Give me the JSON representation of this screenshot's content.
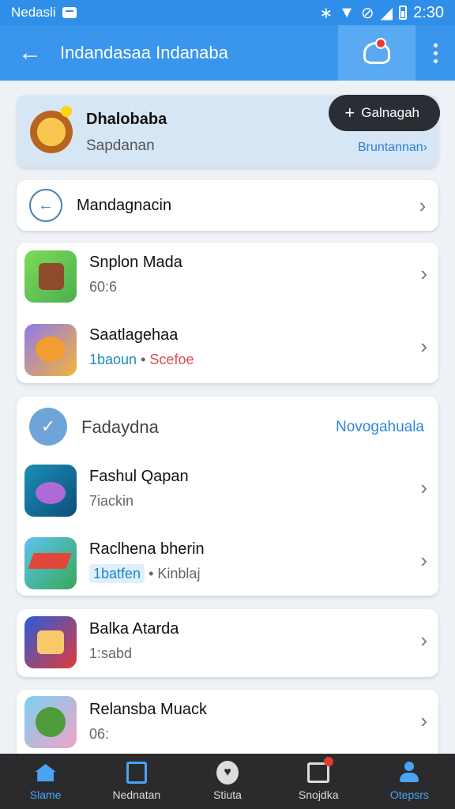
{
  "status_bar": {
    "carrier": "Nedasli",
    "time": "2:30"
  },
  "app_bar": {
    "title": "Indandasaa Indanaba"
  },
  "profile": {
    "name": "Dhalobaba",
    "subtitle": "Sapdanan",
    "join_label": "Galnagah",
    "link_label": "Bruntannan"
  },
  "nav_row": {
    "label": "Mandagnacin"
  },
  "list1": [
    {
      "title": "Snplon Mada",
      "sub": "60:",
      "sub_extra": "6"
    },
    {
      "title": "Saatlagehaa",
      "sub_tag": "1baoun",
      "sub_sep": "•",
      "sub_tag2": "Scefoe"
    }
  ],
  "section": {
    "title": "Fadaydna",
    "link": "Novogahuala"
  },
  "list2": [
    {
      "title": "Fashul Qapan",
      "sub": "7iackin"
    },
    {
      "title": "Raclhena bherin",
      "pill": "1batfen",
      "sub_sep": "•",
      "sub_rest": "Kinblaj"
    }
  ],
  "card3": {
    "title": "Balka Atarda",
    "sub": "1:sabd"
  },
  "card4": {
    "title": "Relansba Muack",
    "sub": "06:"
  },
  "bottom_nav": [
    {
      "label": "Slame"
    },
    {
      "label": "Nednatan"
    },
    {
      "label": "Stiuta"
    },
    {
      "label": "Snojdka"
    },
    {
      "label": "Otepsrs"
    }
  ],
  "colors": {
    "primary": "#3a95ec",
    "nav_bg": "#2b2b2e",
    "accent": "#4aa3f5",
    "badge": "#e53935"
  }
}
